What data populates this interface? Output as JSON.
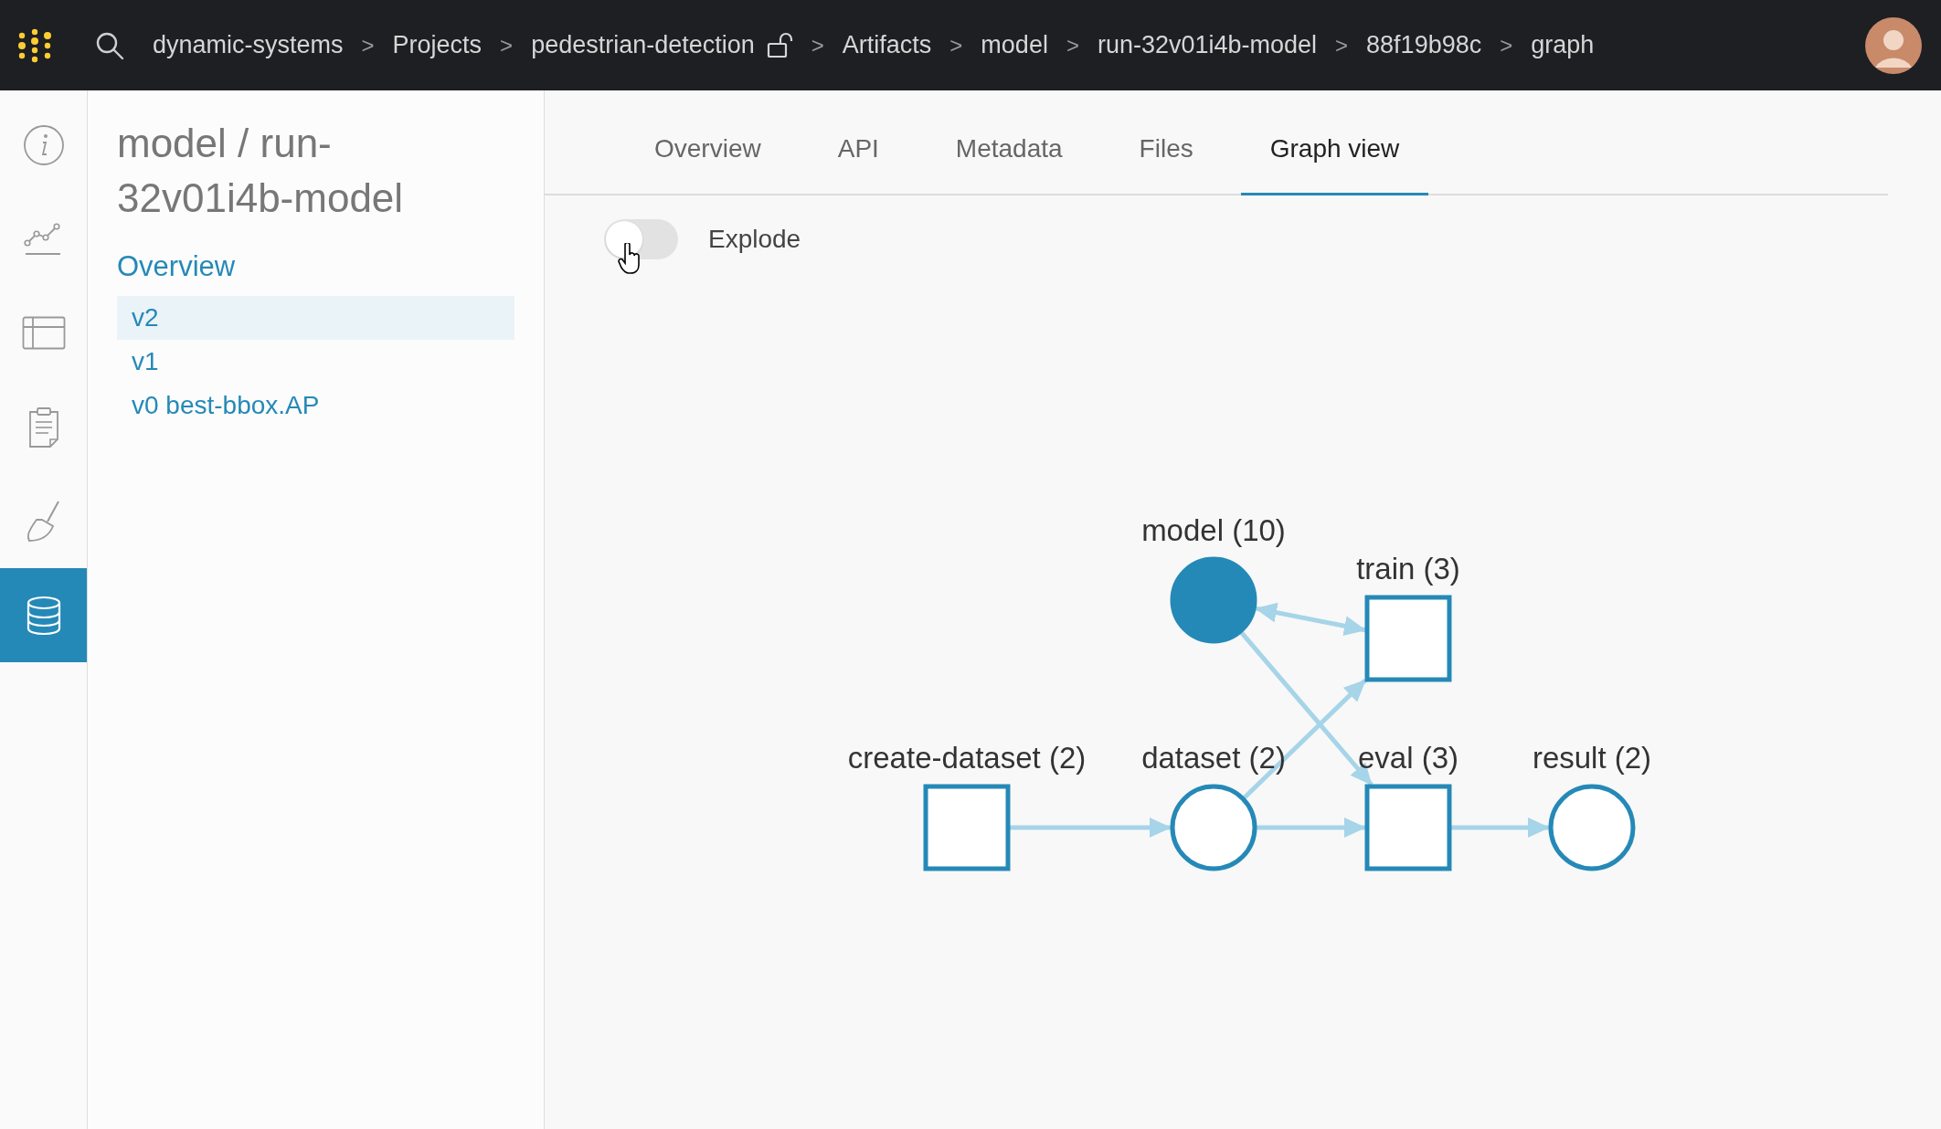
{
  "top_bar": {
    "breadcrumbs": [
      {
        "label": "dynamic-systems",
        "kind": "text"
      },
      {
        "label": "Projects",
        "kind": "text"
      },
      {
        "label": "pedestrian-detection",
        "kind": "project"
      },
      {
        "label": "Artifacts",
        "kind": "text"
      },
      {
        "label": "model",
        "kind": "text"
      },
      {
        "label": "run-32v01i4b-model",
        "kind": "text"
      },
      {
        "label": "88f19b98c",
        "kind": "text"
      },
      {
        "label": "graph",
        "kind": "text"
      }
    ],
    "separator": ">"
  },
  "nav_rail": {
    "items": [
      {
        "kind": "info",
        "selected": false
      },
      {
        "kind": "charts",
        "selected": false
      },
      {
        "kind": "tables",
        "selected": false
      },
      {
        "kind": "reports",
        "selected": false
      },
      {
        "kind": "sweeps",
        "selected": false
      },
      {
        "kind": "artifacts",
        "selected": true
      }
    ]
  },
  "panel": {
    "title": "model / run-32v01i4b-model",
    "overview_link": "Overview",
    "versions": [
      {
        "label": "v2",
        "selected": true
      },
      {
        "label": "v1",
        "selected": false
      },
      {
        "label": "v0 best-bbox.AP",
        "selected": false
      }
    ]
  },
  "tabs": [
    {
      "label": "Overview",
      "selected": false
    },
    {
      "label": "API",
      "selected": false
    },
    {
      "label": "Metadata",
      "selected": false
    },
    {
      "label": "Files",
      "selected": false
    },
    {
      "label": "Graph view",
      "selected": true
    }
  ],
  "explode": {
    "label": "Explode",
    "on": false
  },
  "graph": {
    "nodes": [
      {
        "label": "model (10)",
        "kind": "circle",
        "filled": true
      },
      {
        "label": "train (3)",
        "kind": "square",
        "filled": false
      },
      {
        "label": "create-dataset (2)",
        "kind": "square",
        "filled": false
      },
      {
        "label": "dataset (2)",
        "kind": "circle",
        "filled": false
      },
      {
        "label": "eval (3)",
        "kind": "square",
        "filled": false
      },
      {
        "label": "result (2)",
        "kind": "circle",
        "filled": false
      }
    ]
  }
}
